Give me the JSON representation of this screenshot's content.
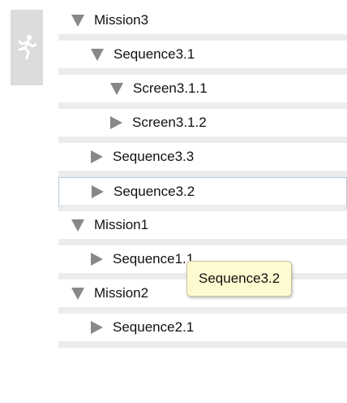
{
  "sidebar": {
    "icon": "running-person-icon"
  },
  "tree": {
    "rows": [
      {
        "label": "Mission3",
        "expanded": true
      },
      {
        "label": "Sequence3.1",
        "expanded": true
      },
      {
        "label": "Screen3.1.1",
        "expanded": true
      },
      {
        "label": "Screen3.1.2",
        "expanded": false
      },
      {
        "label": "Sequence3.3",
        "expanded": false
      },
      {
        "label": "Sequence3.2",
        "expanded": false,
        "selected": true
      },
      {
        "label": "Mission1",
        "expanded": true
      },
      {
        "label": "Sequence1.1",
        "expanded": false
      },
      {
        "label": "Mission2",
        "expanded": true
      },
      {
        "label": "Sequence2.1",
        "expanded": false
      }
    ]
  },
  "tooltip": {
    "text": "Sequence3.2"
  },
  "colors": {
    "arrow": "#888888",
    "separator": "#ececec",
    "selection_border": "#b8cce4",
    "tooltip_bg": "#fffbd0",
    "sidebar_bg": "#dcdcdc"
  }
}
